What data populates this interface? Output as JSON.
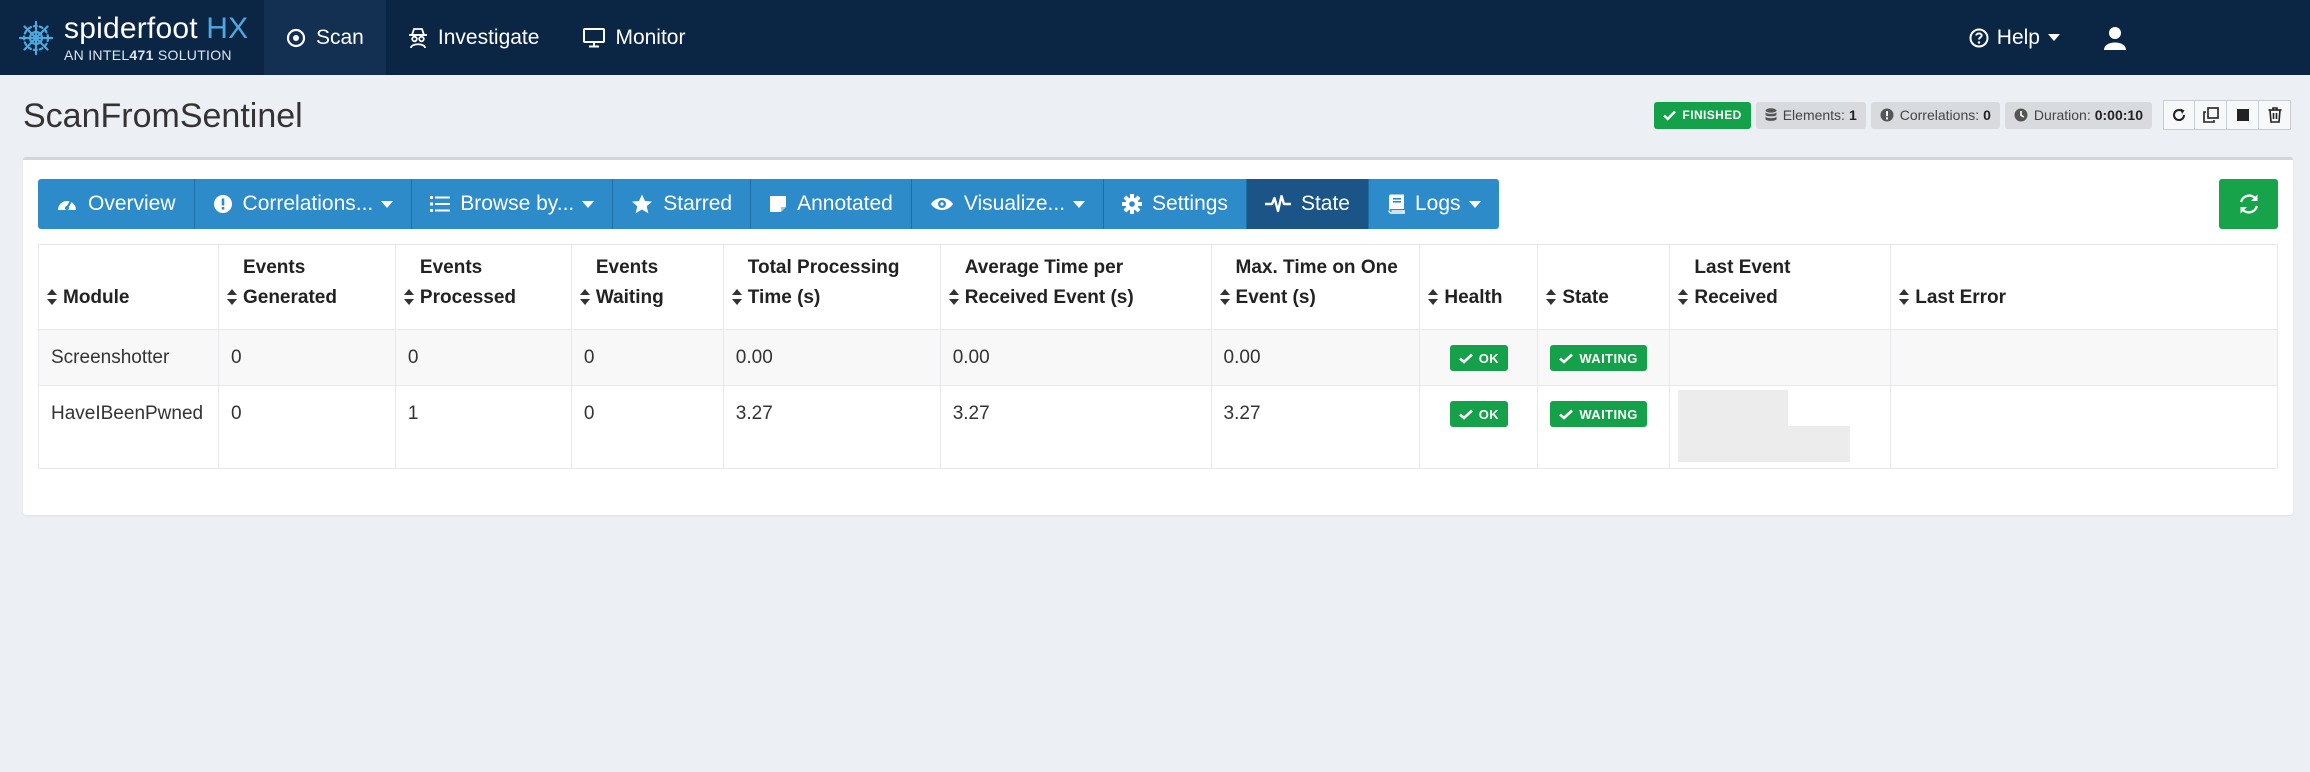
{
  "brand": {
    "name_main": "spiderfoot",
    "name_accent": " HX",
    "sub_pre": "AN INTEL",
    "sub_num": "471",
    "sub_post": " SOLUTION"
  },
  "nav": {
    "scan": "Scan",
    "investigate": "Investigate",
    "monitor": "Monitor",
    "help": "Help"
  },
  "page": {
    "title": "ScanFromSentinel"
  },
  "status": {
    "finished": "FINISHED",
    "elements_label": "Elements:",
    "elements_value": "1",
    "correlations_label": "Correlations:",
    "correlations_value": "0",
    "duration_label": "Duration:",
    "duration_value": "0:00:10"
  },
  "tabs": {
    "overview": "Overview",
    "correlations": "Correlations...",
    "browse": "Browse by...",
    "starred": "Starred",
    "annotated": "Annotated",
    "visualize": "Visualize...",
    "settings": "Settings",
    "state": "State",
    "logs": "Logs"
  },
  "table": {
    "headers": {
      "module": "Module",
      "events_generated": [
        "Events",
        "Generated"
      ],
      "events_processed": [
        "Events",
        "Processed"
      ],
      "events_waiting": [
        "Events",
        "Waiting"
      ],
      "total_time": [
        "Total Processing",
        "Time (s)"
      ],
      "avg_time": [
        "Average Time per",
        "Received Event (s)"
      ],
      "max_time": [
        "Max. Time on One",
        "Event (s)"
      ],
      "health": "Health",
      "state": "State",
      "last_event": [
        "Last Event",
        "Received"
      ],
      "last_error": "Last Error"
    },
    "rows": [
      {
        "module": "Screenshotter",
        "generated": "0",
        "processed": "0",
        "waiting": "0",
        "total": "0.00",
        "avg": "0.00",
        "max": "0.00",
        "health": "OK",
        "state": "WAITING",
        "last_event": "",
        "last_error": ""
      },
      {
        "module": "HaveIBeenPwned",
        "generated": "0",
        "processed": "1",
        "waiting": "0",
        "total": "3.27",
        "avg": "3.27",
        "max": "3.27",
        "health": "OK",
        "state": "WAITING",
        "last_event": "",
        "last_error": ""
      }
    ]
  },
  "colors": {
    "nav_bg": "#0b2545",
    "tab_bg": "#2d8bc9",
    "tab_active": "#1b5587",
    "success": "#15a04a"
  }
}
